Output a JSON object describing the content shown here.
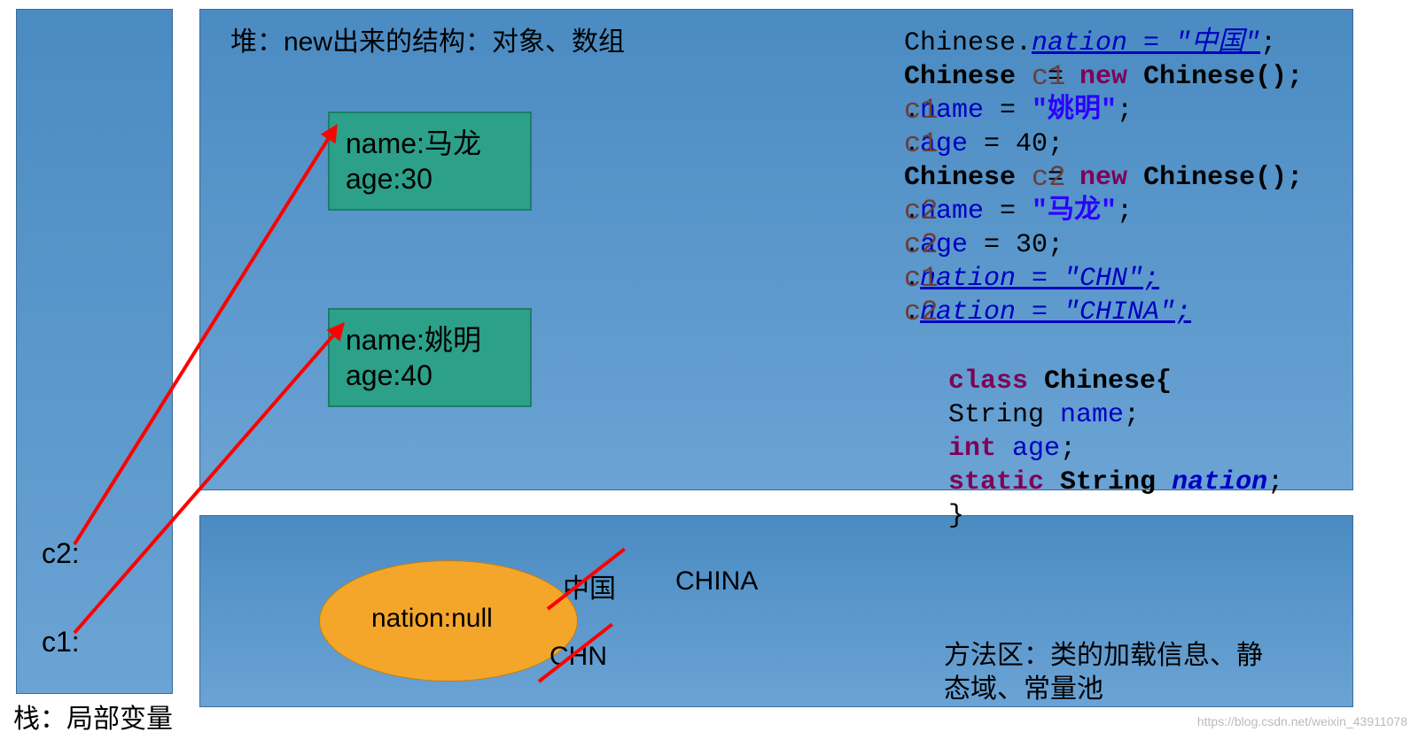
{
  "stack": {
    "label": "栈：局部变量",
    "vars": {
      "c2": "c2:",
      "c1": "c1:"
    }
  },
  "heap": {
    "label": "堆：new出来的结构：对象、数组",
    "obj1": {
      "line1": "name:马龙",
      "line2": "age:30"
    },
    "obj2": {
      "line1": "name:姚明",
      "line2": "age:40"
    }
  },
  "methodArea": {
    "label": "方法区：类的加载信息、静\n态域、常量池",
    "ellipseText": "nation:null",
    "overwrites": {
      "v1": "中国",
      "v2": "CHN",
      "v3": "CHINA"
    }
  },
  "code": {
    "l1a": "Chinese.",
    "l1b": "nation = \"中国\"",
    "l1c": ";",
    "l2a": "Chinese ",
    "l2b": "c1",
    "l2c": " = ",
    "l2d": "new",
    "l2e": " Chinese();",
    "l3a": "c1",
    "l3b": ".",
    "l3c": "name",
    "l3d": " = ",
    "l3e": "\"姚明\"",
    "l3f": ";",
    "l4a": "c1",
    "l4b": ".",
    "l4c": "age",
    "l4d": " = 40;",
    "l5a": "Chinese ",
    "l5b": "c2",
    "l5c": " = ",
    "l5d": "new",
    "l5e": " Chinese();",
    "l6a": "c2",
    "l6b": ".",
    "l6c": "name",
    "l6d": " = ",
    "l6e": "\"马龙\"",
    "l6f": ";",
    "l7a": "c2",
    "l7b": ".",
    "l7c": "age",
    "l7d": " = 30;",
    "l8a": "c1",
    "l8b": ".",
    "l8c": "nation = \"CHN\";",
    "l9a": "c2",
    "l9b": ".",
    "l9c": "nation = \"CHINA\";"
  },
  "classDecl": {
    "l1a": "class",
    "l1b": " Chinese{",
    "l2a": "String ",
    "l2b": "name",
    "l2c": ";",
    "l3a": "int",
    "l3b": " ",
    "l3c": "age",
    "l3d": ";",
    "l4a": "static",
    "l4b": " String ",
    "l4c": "nation",
    "l4d": ";",
    "l5": "}"
  },
  "watermark": "https://blog.csdn.net/weixin_43911078",
  "chart_data": {
    "type": "diagram",
    "description": "Java memory model diagram: stack holds local vars c1, c2 pointing (red arrows) to two Chinese objects on the heap; method area holds static field nation, overwritten 中国 → CHN → CHINA.",
    "stack_vars": [
      "c1",
      "c2"
    ],
    "heap_objects": [
      {
        "ref": "c2",
        "name": "马龙",
        "age": 30
      },
      {
        "ref": "c1",
        "name": "姚明",
        "age": 40
      }
    ],
    "method_area_static": {
      "field": "nation",
      "initial": "null",
      "history": [
        "中国",
        "CHN",
        "CHINA"
      ]
    },
    "source_code": [
      "Chinese.nation = \"中国\";",
      "Chinese c1 = new Chinese();",
      "c1.name = \"姚明\";",
      "c1.age = 40;",
      "Chinese c2 = new Chinese();",
      "c2.name = \"马龙\";",
      "c2.age = 30;",
      "c1.nation = \"CHN\";",
      "c2.nation = \"CHINA\";"
    ],
    "class_declaration": [
      "class Chinese{",
      "String name;",
      "int age;",
      "static String nation;",
      "}"
    ]
  }
}
